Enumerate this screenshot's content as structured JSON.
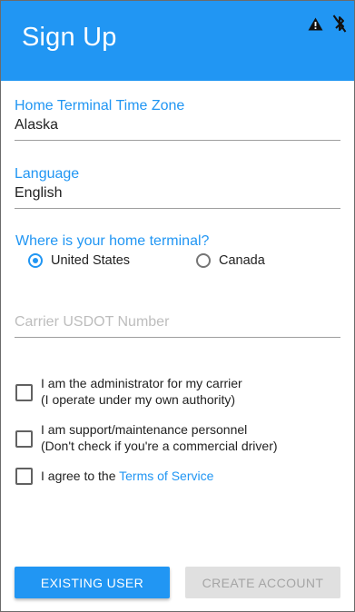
{
  "header": {
    "title": "Sign Up",
    "status_icons": [
      "warning-icon",
      "bluetooth-disabled-icon"
    ],
    "color": "#2196f3"
  },
  "form": {
    "time_zone": {
      "label": "Home Terminal Time Zone",
      "value": "Alaska"
    },
    "language": {
      "label": "Language",
      "value": "English"
    },
    "home_terminal": {
      "question": "Where is your home terminal?",
      "options": [
        {
          "label": "United States",
          "selected": true
        },
        {
          "label": "Canada",
          "selected": false
        }
      ]
    },
    "usdot": {
      "placeholder": "Carrier USDOT Number",
      "value": ""
    },
    "checkboxes": {
      "admin": {
        "line1": "I am the administrator for my carrier",
        "line2": "(I operate under my own authority)",
        "checked": false
      },
      "support": {
        "line1": "I am support/maintenance personnel",
        "line2": "(Don't check if you're a commercial driver)",
        "checked": false
      },
      "terms": {
        "prefix": "I agree to the ",
        "link": "Terms of Service",
        "checked": false
      }
    }
  },
  "buttons": {
    "existing_user": "EXISTING USER",
    "create_account": "CREATE ACCOUNT"
  }
}
